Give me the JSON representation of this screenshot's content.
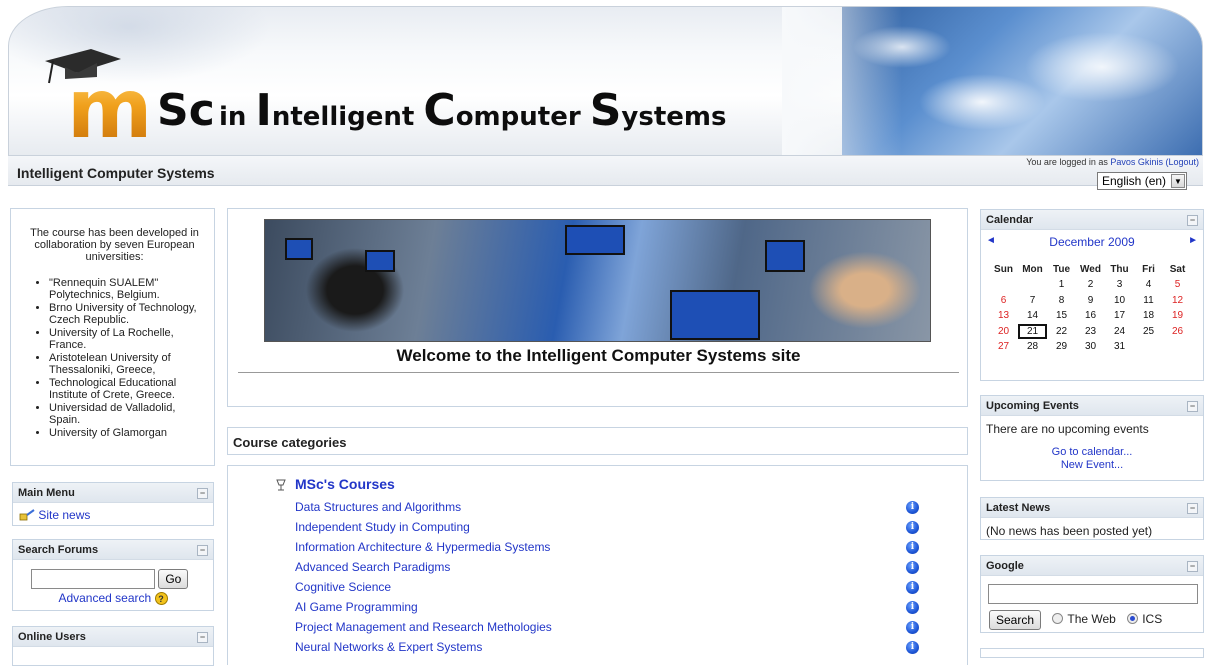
{
  "banner": {
    "logo_m": "m",
    "logo_text": [
      {
        "big": "S",
        "small": "c"
      },
      {
        "big": "I",
        "small": "ntelligent "
      },
      {
        "big": "C",
        "small": "omputer "
      },
      {
        "big": "S",
        "small": "ystems"
      }
    ],
    "logo_lead": "S",
    "logo_lead_rest": "c",
    "word_in": "in ",
    "word_intelligent_i": "I",
    "word_intelligent": "ntelligent ",
    "word_computer_c": "C",
    "word_computer": "omputer ",
    "word_systems_s": "S",
    "word_systems": "ystems"
  },
  "header": {
    "site_name": "Intelligent Computer Systems",
    "login_prefix": "You are logged in as ",
    "login_user": "Pavos Gkinis",
    "logout_label": "(Logout)",
    "language": "English (en)"
  },
  "intro": {
    "lead": "The course has been developed in collaboration by seven European universities:",
    "universities": [
      "\"Rennequin SUALEM\" Polytechnics, Belgium.",
      "Brno University of Technology, Czech Republic.",
      "University of La Rochelle, France.",
      "Aristotelean University of Thessaloniki, Greece,",
      "Technological Educational Institute of Crete, Greece.",
      "Universidad de Valladolid, Spain.",
      "University of Glamorgan"
    ]
  },
  "main_menu": {
    "title": "Main Menu",
    "items": [
      "Site news"
    ]
  },
  "search_forums": {
    "title": "Search Forums",
    "go_label": "Go",
    "advanced_label": "Advanced search",
    "input_value": ""
  },
  "online_users": {
    "title": "Online Users"
  },
  "welcome": {
    "title": "Welcome to the Intelligent Computer Systems site"
  },
  "course_categories": {
    "title": "Course categories",
    "category": "MSc's Courses",
    "courses": [
      "Data Structures and Algorithms",
      "Independent Study in Computing",
      "Information Architecture & Hypermedia Systems",
      "Advanced Search Paradigms",
      "Cognitive Science",
      "AI Game Programming",
      "Project Management and Research Methologies",
      "Neural Networks & Expert Systems"
    ]
  },
  "calendar": {
    "title": "Calendar",
    "month": "December 2009",
    "prev": "◄",
    "next": "►",
    "weekdays": [
      "Sun",
      "Mon",
      "Tue",
      "Wed",
      "Thu",
      "Fri",
      "Sat"
    ],
    "weeks": [
      [
        "",
        "",
        "1",
        "2",
        "3",
        "4",
        "5"
      ],
      [
        "6",
        "7",
        "8",
        "9",
        "10",
        "11",
        "12"
      ],
      [
        "13",
        "14",
        "15",
        "16",
        "17",
        "18",
        "19"
      ],
      [
        "20",
        "21",
        "22",
        "23",
        "24",
        "25",
        "26"
      ],
      [
        "27",
        "28",
        "29",
        "30",
        "31",
        "",
        ""
      ]
    ],
    "today": "21",
    "weekend_color": "#d22222"
  },
  "upcoming": {
    "title": "Upcoming Events",
    "text": "There are no upcoming events",
    "goto_label": "Go to calendar...",
    "new_label": "New Event..."
  },
  "latest_news": {
    "title": "Latest News",
    "text": "(No news has been posted yet)"
  },
  "google": {
    "title": "Google",
    "search_label": "Search",
    "opt_web": "The Web",
    "opt_ics": "ICS",
    "selected": "ICS",
    "input_value": ""
  },
  "colors": {
    "link": "#2236c8",
    "block_border": "#c7d4e2",
    "accent_orange": "#f0a01c"
  }
}
